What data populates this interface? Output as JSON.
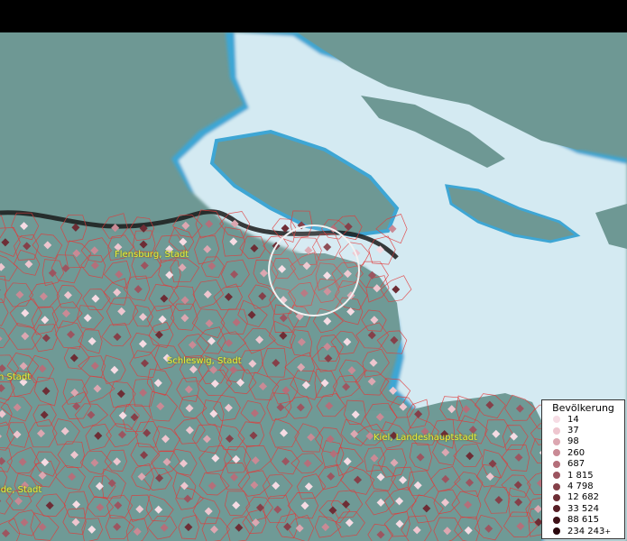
{
  "map": {
    "cities": [
      {
        "id": "flensburg",
        "label": "Flensburg, Stadt"
      },
      {
        "id": "schleswig",
        "label": "Schleswig, Stadt"
      },
      {
        "id": "kiel",
        "label": "Kiel, Landeshauptstadt"
      },
      {
        "id": "left-stadt",
        "label": "n Stadt"
      },
      {
        "id": "left-stadt2",
        "label": "ide, Stadt"
      }
    ]
  },
  "legend": {
    "title": "Bevölkerung",
    "classes": [
      {
        "label": "14",
        "color": "#f6dce4"
      },
      {
        "label": "37",
        "color": "#eec6cf"
      },
      {
        "label": "98",
        "color": "#dca7b1"
      },
      {
        "label": "260",
        "color": "#c98a95"
      },
      {
        "label": "687",
        "color": "#b46f7a"
      },
      {
        "label": "1 815",
        "color": "#9c5560"
      },
      {
        "label": "4 798",
        "color": "#854049"
      },
      {
        "label": "12 682",
        "color": "#6d2d35"
      },
      {
        "label": "33 524",
        "color": "#571e25"
      },
      {
        "label": "88 615",
        "color": "#3f1218"
      },
      {
        "label": "234 243",
        "color": "#2a080d"
      }
    ],
    "overflow_mark": "+"
  },
  "colors": {
    "land": "#6f9a96",
    "water": "#cfe8f0",
    "coast": "#3fa8d6",
    "boundary": "#e23a3a",
    "border": "#1a1a1a"
  }
}
